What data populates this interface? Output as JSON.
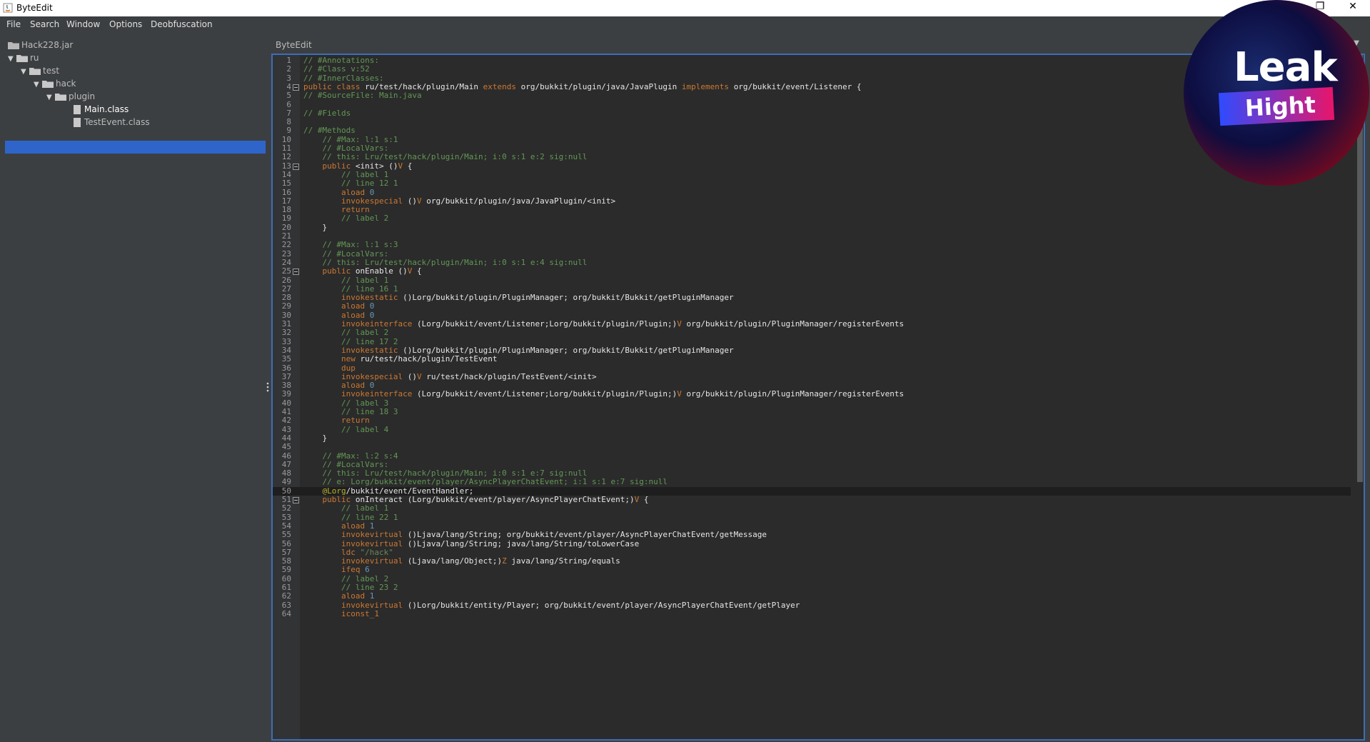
{
  "window": {
    "title": "ByteEdit",
    "buttons": {
      "restore": "❐",
      "close": "✕"
    }
  },
  "menu": [
    "File",
    "Search",
    "Window",
    "Options",
    "Deobfuscation"
  ],
  "tree": [
    {
      "label": "Hack228.jar",
      "depth": 0,
      "kind": "jar"
    },
    {
      "label": "ru",
      "depth": 0,
      "kind": "folder"
    },
    {
      "label": "test",
      "depth": 1,
      "kind": "folder"
    },
    {
      "label": "hack",
      "depth": 2,
      "kind": "folder"
    },
    {
      "label": "plugin",
      "depth": 3,
      "kind": "folder"
    },
    {
      "label": "Main.class",
      "depth": 4,
      "kind": "file",
      "selected": true
    },
    {
      "label": "TestEvent.class",
      "depth": 4,
      "kind": "file"
    }
  ],
  "editor": {
    "tab": "ByteEdit",
    "current_line": 50,
    "lines": [
      {
        "n": 1,
        "segs": [
          [
            "c",
            "// #Annotations:"
          ]
        ]
      },
      {
        "n": 2,
        "segs": [
          [
            "c",
            "// #Class v:52"
          ]
        ]
      },
      {
        "n": 3,
        "segs": [
          [
            "c",
            "// #InnerClasses:"
          ]
        ]
      },
      {
        "n": 4,
        "fold": true,
        "segs": [
          [
            "k",
            "public class "
          ],
          [
            "p",
            "ru/test/hack/plugin/Main "
          ],
          [
            "k",
            "extends "
          ],
          [
            "p",
            "org/bukkit/plugin/java/JavaPlugin "
          ],
          [
            "k",
            "implements "
          ],
          [
            "p",
            "org/bukkit/event/Listener {"
          ]
        ]
      },
      {
        "n": 5,
        "segs": [
          [
            "c",
            "// #SourceFile: Main.java"
          ]
        ]
      },
      {
        "n": 6,
        "segs": []
      },
      {
        "n": 7,
        "segs": [
          [
            "c",
            "// #Fields"
          ]
        ]
      },
      {
        "n": 8,
        "segs": []
      },
      {
        "n": 9,
        "segs": [
          [
            "c",
            "// #Methods"
          ]
        ]
      },
      {
        "n": 10,
        "segs": [
          [
            "p",
            "    "
          ],
          [
            "c",
            "// #Max: l:1 s:1"
          ]
        ]
      },
      {
        "n": 11,
        "segs": [
          [
            "p",
            "    "
          ],
          [
            "c",
            "// #LocalVars:"
          ]
        ]
      },
      {
        "n": 12,
        "segs": [
          [
            "p",
            "    "
          ],
          [
            "c",
            "// this: Lru/test/hack/plugin/Main; i:0 s:1 e:2 sig:null"
          ]
        ]
      },
      {
        "n": 13,
        "fold": true,
        "segs": [
          [
            "p",
            "    "
          ],
          [
            "k",
            "public "
          ],
          [
            "p",
            "<init> ()"
          ],
          [
            "k",
            "V"
          ],
          [
            "p",
            " {"
          ]
        ]
      },
      {
        "n": 14,
        "segs": [
          [
            "p",
            "        "
          ],
          [
            "c",
            "// label 1"
          ]
        ]
      },
      {
        "n": 15,
        "segs": [
          [
            "p",
            "        "
          ],
          [
            "c",
            "// line 12 1"
          ]
        ]
      },
      {
        "n": 16,
        "segs": [
          [
            "p",
            "        "
          ],
          [
            "k",
            "aload "
          ],
          [
            "n",
            "0"
          ]
        ]
      },
      {
        "n": 17,
        "segs": [
          [
            "p",
            "        "
          ],
          [
            "k",
            "invokespecial "
          ],
          [
            "p",
            "()"
          ],
          [
            "k",
            "V"
          ],
          [
            "p",
            " org/bukkit/plugin/java/JavaPlugin/<init>"
          ]
        ]
      },
      {
        "n": 18,
        "segs": [
          [
            "p",
            "        "
          ],
          [
            "k",
            "return"
          ]
        ]
      },
      {
        "n": 19,
        "segs": [
          [
            "p",
            "        "
          ],
          [
            "c",
            "// label 2"
          ]
        ]
      },
      {
        "n": 20,
        "segs": [
          [
            "p",
            "    }"
          ]
        ]
      },
      {
        "n": 21,
        "segs": []
      },
      {
        "n": 22,
        "segs": [
          [
            "p",
            "    "
          ],
          [
            "c",
            "// #Max: l:1 s:3"
          ]
        ]
      },
      {
        "n": 23,
        "segs": [
          [
            "p",
            "    "
          ],
          [
            "c",
            "// #LocalVars:"
          ]
        ]
      },
      {
        "n": 24,
        "segs": [
          [
            "p",
            "    "
          ],
          [
            "c",
            "// this: Lru/test/hack/plugin/Main; i:0 s:1 e:4 sig:null"
          ]
        ]
      },
      {
        "n": 25,
        "fold": true,
        "segs": [
          [
            "p",
            "    "
          ],
          [
            "k",
            "public "
          ],
          [
            "p",
            "onEnable ()"
          ],
          [
            "k",
            "V"
          ],
          [
            "p",
            " {"
          ]
        ]
      },
      {
        "n": 26,
        "segs": [
          [
            "p",
            "        "
          ],
          [
            "c",
            "// label 1"
          ]
        ]
      },
      {
        "n": 27,
        "segs": [
          [
            "p",
            "        "
          ],
          [
            "c",
            "// line 16 1"
          ]
        ]
      },
      {
        "n": 28,
        "segs": [
          [
            "p",
            "        "
          ],
          [
            "k",
            "invokestatic "
          ],
          [
            "p",
            "()Lorg/bukkit/plugin/PluginManager; org/bukkit/Bukkit/getPluginManager"
          ]
        ]
      },
      {
        "n": 29,
        "segs": [
          [
            "p",
            "        "
          ],
          [
            "k",
            "aload "
          ],
          [
            "n",
            "0"
          ]
        ]
      },
      {
        "n": 30,
        "segs": [
          [
            "p",
            "        "
          ],
          [
            "k",
            "aload "
          ],
          [
            "n",
            "0"
          ]
        ]
      },
      {
        "n": 31,
        "segs": [
          [
            "p",
            "        "
          ],
          [
            "k",
            "invokeinterface "
          ],
          [
            "p",
            "(Lorg/bukkit/event/Listener;Lorg/bukkit/plugin/Plugin;)"
          ],
          [
            "k",
            "V"
          ],
          [
            "p",
            " org/bukkit/plugin/PluginManager/registerEvents"
          ]
        ]
      },
      {
        "n": 32,
        "segs": [
          [
            "p",
            "        "
          ],
          [
            "c",
            "// label 2"
          ]
        ]
      },
      {
        "n": 33,
        "segs": [
          [
            "p",
            "        "
          ],
          [
            "c",
            "// line 17 2"
          ]
        ]
      },
      {
        "n": 34,
        "segs": [
          [
            "p",
            "        "
          ],
          [
            "k",
            "invokestatic "
          ],
          [
            "p",
            "()Lorg/bukkit/plugin/PluginManager; org/bukkit/Bukkit/getPluginManager"
          ]
        ]
      },
      {
        "n": 35,
        "segs": [
          [
            "p",
            "        "
          ],
          [
            "k",
            "new "
          ],
          [
            "p",
            "ru/test/hack/plugin/TestEvent"
          ]
        ]
      },
      {
        "n": 36,
        "segs": [
          [
            "p",
            "        "
          ],
          [
            "k",
            "dup"
          ]
        ]
      },
      {
        "n": 37,
        "segs": [
          [
            "p",
            "        "
          ],
          [
            "k",
            "invokespecial "
          ],
          [
            "p",
            "()"
          ],
          [
            "k",
            "V"
          ],
          [
            "p",
            " ru/test/hack/plugin/TestEvent/<init>"
          ]
        ]
      },
      {
        "n": 38,
        "segs": [
          [
            "p",
            "        "
          ],
          [
            "k",
            "aload "
          ],
          [
            "n",
            "0"
          ]
        ]
      },
      {
        "n": 39,
        "segs": [
          [
            "p",
            "        "
          ],
          [
            "k",
            "invokeinterface "
          ],
          [
            "p",
            "(Lorg/bukkit/event/Listener;Lorg/bukkit/plugin/Plugin;)"
          ],
          [
            "k",
            "V"
          ],
          [
            "p",
            " org/bukkit/plugin/PluginManager/registerEvents"
          ]
        ]
      },
      {
        "n": 40,
        "segs": [
          [
            "p",
            "        "
          ],
          [
            "c",
            "// label 3"
          ]
        ]
      },
      {
        "n": 41,
        "segs": [
          [
            "p",
            "        "
          ],
          [
            "c",
            "// line 18 3"
          ]
        ]
      },
      {
        "n": 42,
        "segs": [
          [
            "p",
            "        "
          ],
          [
            "k",
            "return"
          ]
        ]
      },
      {
        "n": 43,
        "segs": [
          [
            "p",
            "        "
          ],
          [
            "c",
            "// label 4"
          ]
        ]
      },
      {
        "n": 44,
        "segs": [
          [
            "p",
            "    }"
          ]
        ]
      },
      {
        "n": 45,
        "segs": []
      },
      {
        "n": 46,
        "segs": [
          [
            "p",
            "    "
          ],
          [
            "c",
            "// #Max: l:2 s:4"
          ]
        ]
      },
      {
        "n": 47,
        "segs": [
          [
            "p",
            "    "
          ],
          [
            "c",
            "// #LocalVars:"
          ]
        ]
      },
      {
        "n": 48,
        "segs": [
          [
            "p",
            "    "
          ],
          [
            "c",
            "// this: Lru/test/hack/plugin/Main; i:0 s:1 e:7 sig:null"
          ]
        ]
      },
      {
        "n": 49,
        "segs": [
          [
            "p",
            "    "
          ],
          [
            "c",
            "// e: Lorg/bukkit/event/player/AsyncPlayerChatEvent; i:1 s:1 e:7 sig:null"
          ]
        ]
      },
      {
        "n": 50,
        "segs": [
          [
            "p",
            "    "
          ],
          [
            "a",
            "@Lorg"
          ],
          [
            "p",
            "/bukkit/event/EventHandler;"
          ]
        ]
      },
      {
        "n": 51,
        "fold": true,
        "segs": [
          [
            "p",
            "    "
          ],
          [
            "k",
            "public "
          ],
          [
            "p",
            "onInteract (Lorg/bukkit/event/player/AsyncPlayerChatEvent;)"
          ],
          [
            "k",
            "V"
          ],
          [
            "p",
            " {"
          ]
        ]
      },
      {
        "n": 52,
        "segs": [
          [
            "p",
            "        "
          ],
          [
            "c",
            "// label 1"
          ]
        ]
      },
      {
        "n": 53,
        "segs": [
          [
            "p",
            "        "
          ],
          [
            "c",
            "// line 22 1"
          ]
        ]
      },
      {
        "n": 54,
        "segs": [
          [
            "p",
            "        "
          ],
          [
            "k",
            "aload "
          ],
          [
            "n",
            "1"
          ]
        ]
      },
      {
        "n": 55,
        "segs": [
          [
            "p",
            "        "
          ],
          [
            "k",
            "invokevirtual "
          ],
          [
            "p",
            "()Ljava/lang/String; org/bukkit/event/player/AsyncPlayerChatEvent/getMessage"
          ]
        ]
      },
      {
        "n": 56,
        "segs": [
          [
            "p",
            "        "
          ],
          [
            "k",
            "invokevirtual "
          ],
          [
            "p",
            "()Ljava/lang/String; java/lang/String/toLowerCase"
          ]
        ]
      },
      {
        "n": 57,
        "segs": [
          [
            "p",
            "        "
          ],
          [
            "k",
            "ldc "
          ],
          [
            "s",
            "\"/hack\""
          ]
        ]
      },
      {
        "n": 58,
        "segs": [
          [
            "p",
            "        "
          ],
          [
            "k",
            "invokevirtual "
          ],
          [
            "p",
            "(Ljava/lang/Object;)"
          ],
          [
            "k",
            "Z"
          ],
          [
            "p",
            " java/lang/String/equals"
          ]
        ]
      },
      {
        "n": 59,
        "segs": [
          [
            "p",
            "        "
          ],
          [
            "k",
            "ifeq "
          ],
          [
            "n",
            "6"
          ]
        ]
      },
      {
        "n": 60,
        "segs": [
          [
            "p",
            "        "
          ],
          [
            "c",
            "// label 2"
          ]
        ]
      },
      {
        "n": 61,
        "segs": [
          [
            "p",
            "        "
          ],
          [
            "c",
            "// line 23 2"
          ]
        ]
      },
      {
        "n": 62,
        "segs": [
          [
            "p",
            "        "
          ],
          [
            "k",
            "aload "
          ],
          [
            "n",
            "1"
          ]
        ]
      },
      {
        "n": 63,
        "segs": [
          [
            "p",
            "        "
          ],
          [
            "k",
            "invokevirtual "
          ],
          [
            "p",
            "()Lorg/bukkit/entity/Player; org/bukkit/event/player/AsyncPlayerChatEvent/getPlayer"
          ]
        ]
      },
      {
        "n": 64,
        "segs": [
          [
            "p",
            "        "
          ],
          [
            "k",
            "iconst_1"
          ]
        ]
      }
    ]
  },
  "overlay": {
    "leak": "Leak",
    "hight": "Hight"
  },
  "colors": {
    "accent": "#3d6db8",
    "selection": "#2f65ca",
    "keyword": "#cc7832",
    "comment": "#629755",
    "number": "#6897bb"
  }
}
